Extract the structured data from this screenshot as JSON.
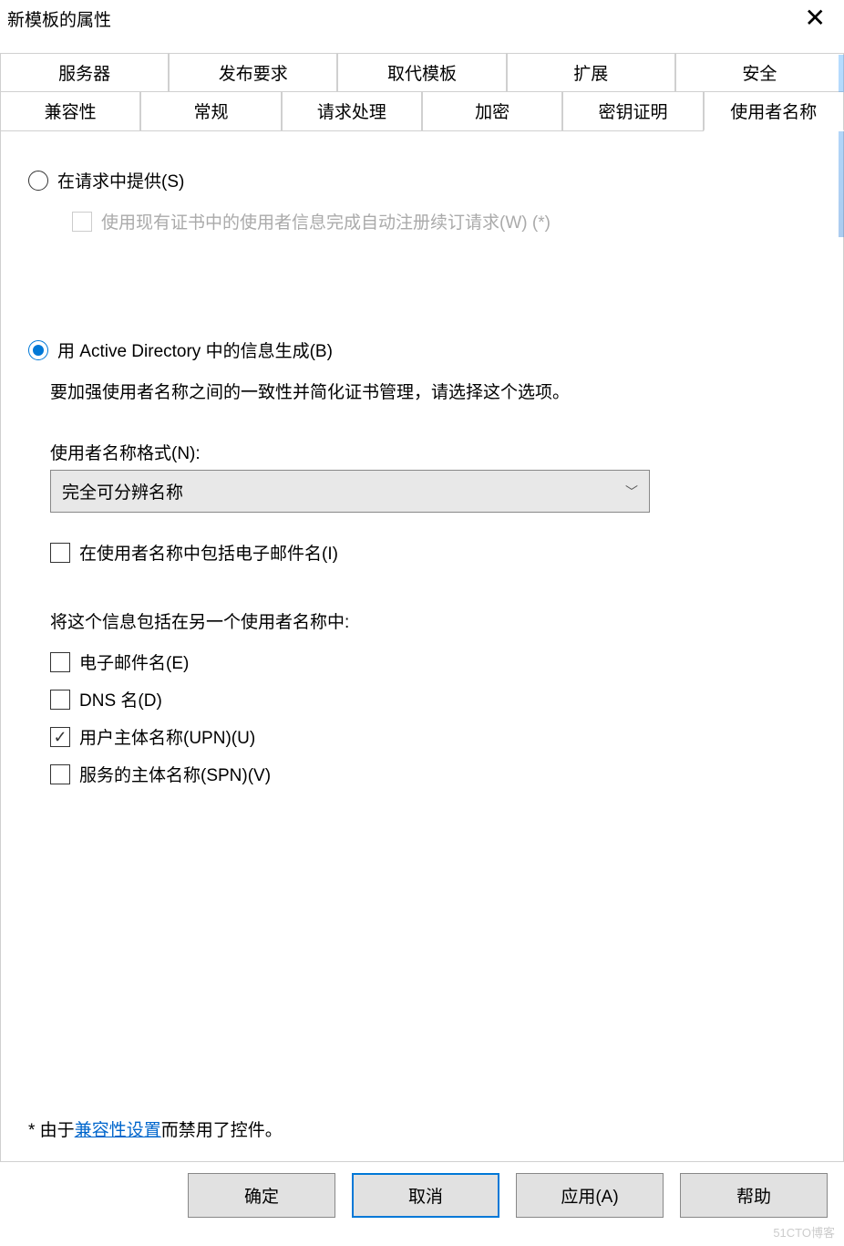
{
  "title": "新模板的属性",
  "tabs_row1": [
    "服务器",
    "发布要求",
    "取代模板",
    "扩展",
    "安全"
  ],
  "tabs_row2": [
    "兼容性",
    "常规",
    "请求处理",
    "加密",
    "密钥证明",
    "使用者名称"
  ],
  "active_tab": "使用者名称",
  "radio_supply": "在请求中提供(S)",
  "checkbox_autoenroll": "使用现有证书中的使用者信息完成自动注册续订请求(W) (*)",
  "radio_ad": "用 Active Directory 中的信息生成(B)",
  "ad_desc": "要加强使用者名称之间的一致性并简化证书管理，请选择这个选项。",
  "format_label": "使用者名称格式(N):",
  "format_value": "完全可分辨名称",
  "cb_email_in_subject": "在使用者名称中包括电子邮件名(I)",
  "alt_label": "将这个信息包括在另一个使用者名称中:",
  "cb_email": "电子邮件名(E)",
  "cb_dns": "DNS 名(D)",
  "cb_upn": "用户主体名称(UPN)(U)",
  "cb_spn": "服务的主体名称(SPN)(V)",
  "footer_prefix": "* 由于",
  "footer_link": "兼容性设置",
  "footer_suffix": "而禁用了控件。",
  "btn_ok": "确定",
  "btn_cancel": "取消",
  "btn_apply": "应用(A)",
  "btn_help": "帮助",
  "watermark": "51CTO博客"
}
